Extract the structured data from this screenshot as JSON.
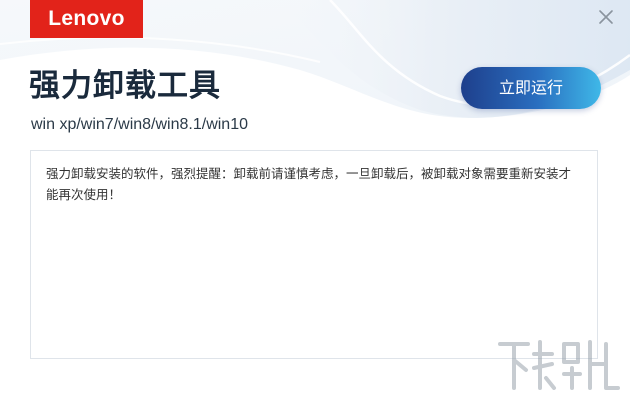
{
  "window": {
    "logo_text": "Lenovo",
    "title": "强力卸载工具",
    "os_compat": "win xp/win7/win8/win8.1/win10",
    "run_button_label": "立即运行",
    "info_text": "强力卸载安装的软件，强烈提醒：卸载前请谨慎考虑，一旦卸载后，被卸载对象需要重新安装才能再次使用！",
    "close_icon": "close-icon"
  },
  "colors": {
    "brand_red": "#e2231a",
    "title_text": "#1a2a3c",
    "button_gradient_start": "#1e3f8c",
    "button_gradient_end": "#3fb8e8",
    "box_border": "#dfe4ea"
  }
}
